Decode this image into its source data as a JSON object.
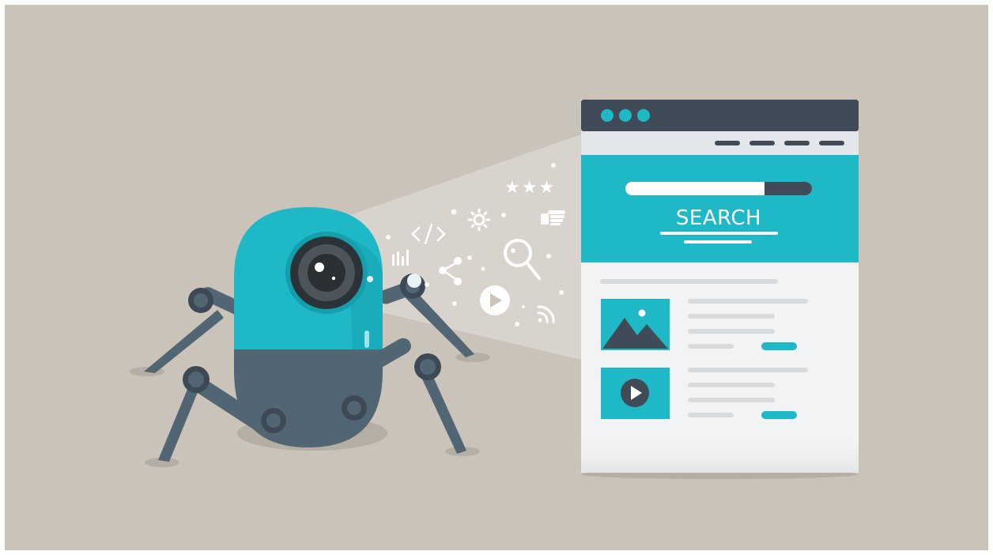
{
  "page": {
    "search_label": "SEARCH",
    "rating_stars": "★★★"
  },
  "colors": {
    "background": "#c9c3ba",
    "teal": "#1fb8c7",
    "teal_dark": "#159eab",
    "slate": "#526573",
    "slate_dark": "#3d4a55",
    "browser_bar": "#3f4c57",
    "white": "#ffffff",
    "light_gray": "#e3e6ea"
  },
  "icons": [
    "robot-spider",
    "camera-lens-eye",
    "bar-chart-icon",
    "code-icon",
    "gear-icon",
    "star-icon",
    "hand-pointer-icon",
    "share-icon",
    "magnifier-icon",
    "play-icon",
    "rss-icon",
    "image-placeholder-icon",
    "video-play-icon"
  ]
}
